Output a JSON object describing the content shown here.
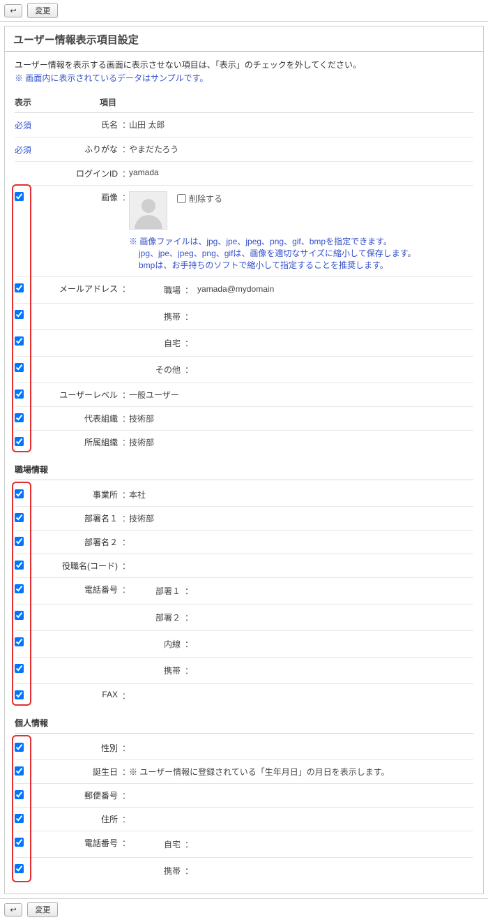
{
  "toolbar": {
    "back_glyph": "↩",
    "change_label": "変更"
  },
  "panel": {
    "title": "ユーザー情報表示項目設定",
    "instruction": "ユーザー情報を表示する画面に表示させない項目は、「表示」のチェックを外してください。",
    "sample_note": "※ 画面内に表示されているデータはサンプルです。"
  },
  "headers": {
    "display": "表示",
    "item": "項目"
  },
  "required_label": "必須",
  "rows": {
    "name": {
      "label": "氏名",
      "value": "山田 太郎"
    },
    "furigana": {
      "label": "ふりがな",
      "value": "やまだたろう"
    },
    "login": {
      "label": "ログインID",
      "value": "yamada"
    },
    "image": {
      "label": "画像",
      "delete_label": "削除する",
      "note1": "※ 画像ファイルは、jpg、jpe、jpeg、png、gif、bmpを指定できます。",
      "note2": "jpg、jpe、jpeg、png、gifは、画像を適切なサイズに縮小して保存します。",
      "note3": "bmpは、お手持ちのソフトで縮小して指定することを推奨します。"
    },
    "email": {
      "label": "メールアドレス",
      "work": {
        "label": "職場",
        "value": "yamada@mydomain"
      },
      "mobile": {
        "label": "携帯",
        "value": ""
      },
      "home": {
        "label": "自宅",
        "value": ""
      },
      "other": {
        "label": "その他",
        "value": ""
      }
    },
    "level": {
      "label": "ユーザーレベル",
      "value": "一般ユーザー"
    },
    "reporg": {
      "label": "代表組織",
      "value": "技術部"
    },
    "org": {
      "label": "所属組織",
      "value": "技術部"
    }
  },
  "work_section": {
    "title": "職場情報",
    "office": {
      "label": "事業所",
      "value": "本社"
    },
    "div1": {
      "label": "部署名１",
      "value": "技術部"
    },
    "div2": {
      "label": "部署名２",
      "value": ""
    },
    "pos": {
      "label": "役職名(コード)",
      "value": ""
    },
    "phone": {
      "label": "電話番号",
      "d1": {
        "label": "部署１",
        "value": ""
      },
      "d2": {
        "label": "部署２",
        "value": ""
      },
      "ext": {
        "label": "内線",
        "value": ""
      },
      "mob": {
        "label": "携帯",
        "value": ""
      }
    },
    "fax": {
      "label": "FAX",
      "value": ""
    }
  },
  "personal_section": {
    "title": "個人情報",
    "gender": {
      "label": "性別",
      "value": ""
    },
    "bday": {
      "label": "誕生日",
      "note": "※ ユーザー情報に登録されている「生年月日」の月日を表示します。"
    },
    "zip": {
      "label": "郵便番号",
      "value": ""
    },
    "addr": {
      "label": "住所",
      "value": ""
    },
    "phone": {
      "label": "電話番号",
      "home": {
        "label": "自宅",
        "value": ""
      },
      "mob": {
        "label": "携帯",
        "value": ""
      }
    }
  }
}
